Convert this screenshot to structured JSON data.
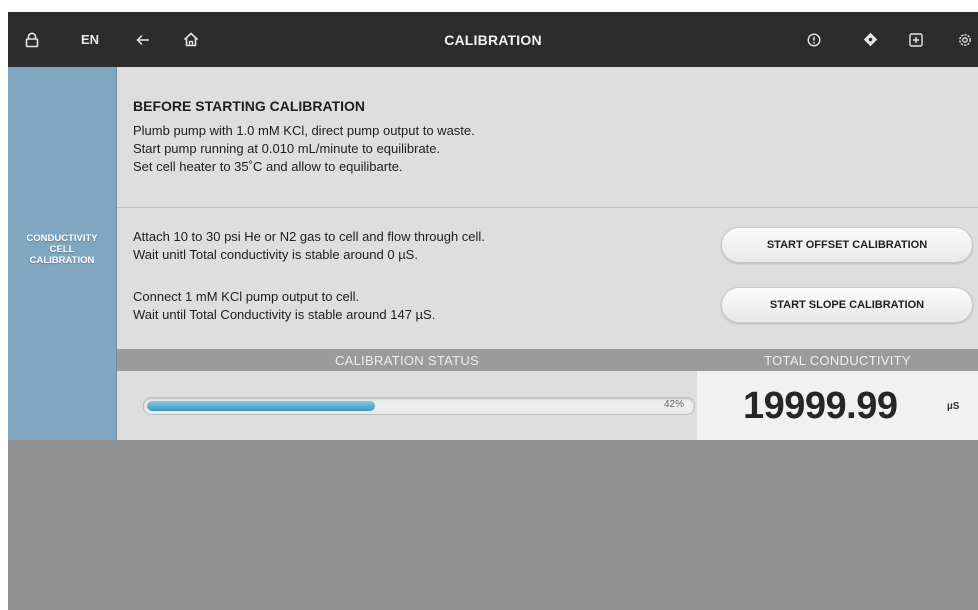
{
  "topbar": {
    "lock_icon": "lock-icon",
    "language": "EN",
    "back_icon": "back-arrow-icon",
    "home_icon": "home-icon",
    "title": "CALIBRATION",
    "alert_icon": "alert-icon",
    "diamond_icon": "diamond-icon",
    "add_icon": "plus-box-icon",
    "settings_icon": "gear-icon"
  },
  "sidebar": {
    "label_line1": "CONDUCTIVITY",
    "label_line2": "CELL",
    "label_line3": "CALIBRATION"
  },
  "before": {
    "title": "BEFORE STARTING CALIBRATION",
    "line1": "Plumb pump with 1.0 mM KCl, direct pump output to waste.",
    "line2": "Start pump running at 0.010 mL/minute to equilibrate.",
    "line3": "Set cell heater to 35˚C and allow to equilibarte."
  },
  "offset_step": {
    "line1": "Attach 10 to 30 psi He or N2 gas to cell and flow through cell.",
    "line2": "Wait unitl Total conductivity is stable around 0 µS.",
    "button_label": "START OFFSET CALIBRATION"
  },
  "slope_step": {
    "line1": "Connect 1 mM KCl pump output to cell.",
    "line2": "Wait until Total Conductivity is stable around 147 µS.",
    "button_label": "START SLOPE CALIBRATION"
  },
  "status": {
    "header": "CALIBRATION STATUS",
    "progress_percent": 42,
    "progress_label": "42%"
  },
  "conductivity": {
    "header": "TOTAL CONDUCTIVITY",
    "value": "19999.99",
    "unit": "µS"
  },
  "colors": {
    "topbar": "#2c2c2c",
    "sidebar": "#7fa7c2",
    "progress_fill": "#4aa3c8"
  }
}
